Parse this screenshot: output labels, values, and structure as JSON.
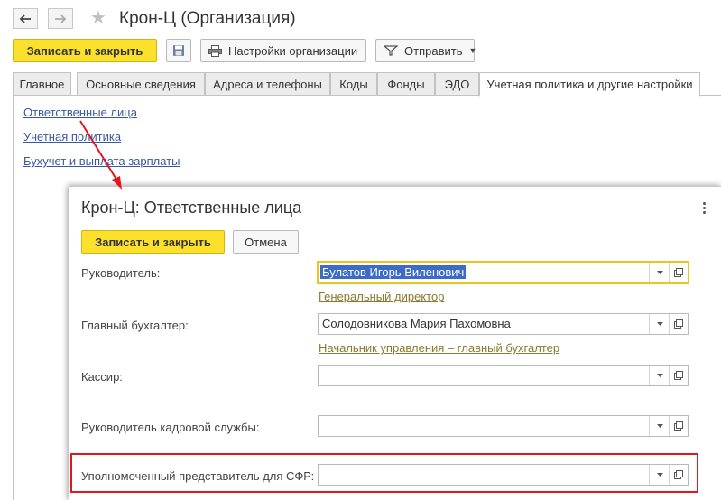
{
  "window": {
    "title": "Крон-Ц (Организация)",
    "back_icon": "arrow-left-icon",
    "forward_icon": "arrow-right-icon",
    "favorite_icon": "star-icon"
  },
  "toolbar": {
    "save_close_label": "Записать и закрыть",
    "save_icon": "floppy-disk-icon",
    "settings_label": "Настройки организации",
    "send_label": "Отправить"
  },
  "tabs": [
    {
      "label": "Главное"
    },
    {
      "label": "Основные сведения"
    },
    {
      "label": "Адреса и телефоны"
    },
    {
      "label": "Коды"
    },
    {
      "label": "Фонды"
    },
    {
      "label": "ЭДО"
    },
    {
      "label": "Учетная политика и другие настройки"
    }
  ],
  "links": [
    {
      "label": "Ответственные лица"
    },
    {
      "label": "Учетная политика"
    },
    {
      "label": "Бухучет и выплата зарплаты"
    }
  ],
  "dialog": {
    "title": "Крон-Ц: Ответственные лица",
    "save_close_label": "Записать и закрыть",
    "cancel_label": "Отмена",
    "fields": [
      {
        "label": "Руководитель:",
        "value": "Булатов Игорь Виленович",
        "position_link": "Генеральный директор"
      },
      {
        "label": "Главный бухгалтер:",
        "value": "Солодовникова Мария Пахомовна",
        "position_link": "Начальник управления – главный бухгалтер"
      },
      {
        "label": "Кассир:",
        "value": ""
      },
      {
        "label": "Руководитель кадровой службы:",
        "value": ""
      },
      {
        "label": "Уполномоченный представитель для СФР:",
        "value": ""
      }
    ]
  },
  "colors": {
    "accent_yellow": "#fbe12b",
    "highlight_red": "#e2171b",
    "link_blue": "#3a57a1"
  }
}
